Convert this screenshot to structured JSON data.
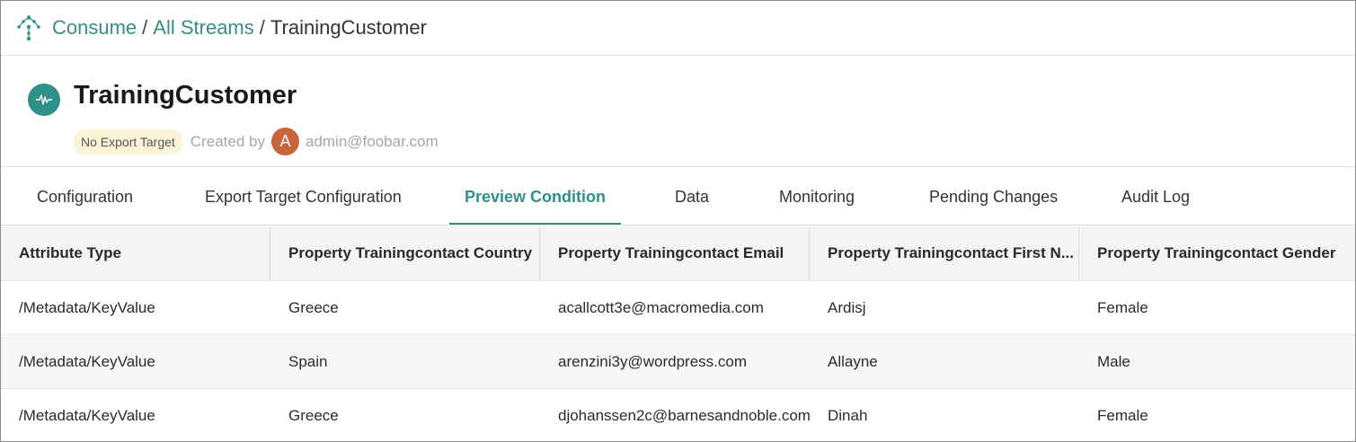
{
  "breadcrumb": {
    "items": [
      {
        "label": "Consume"
      },
      {
        "label": "All Streams"
      }
    ],
    "separator": "/",
    "current": "TrainingCustomer"
  },
  "header": {
    "title": "TrainingCustomer",
    "badge": "No Export Target",
    "created_by_label": "Created by",
    "avatar_initial": "A",
    "creator": "admin@foobar.com"
  },
  "tabs": [
    {
      "label": "Configuration"
    },
    {
      "label": "Export Target Configuration"
    },
    {
      "label": "Preview Condition",
      "active": true
    },
    {
      "label": "Data"
    },
    {
      "label": "Monitoring"
    },
    {
      "label": "Pending Changes"
    },
    {
      "label": "Audit Log"
    }
  ],
  "table": {
    "columns": [
      "Attribute Type",
      "Property Trainingcontact Country",
      "Property Trainingcontact Email",
      "Property Trainingcontact First N...",
      "Property Trainingcontact Gender"
    ],
    "rows": [
      [
        "/Metadata/KeyValue",
        "Greece",
        "acallcott3e@macromedia.com",
        "Ardisj",
        "Female"
      ],
      [
        "/Metadata/KeyValue",
        "Spain",
        "arenzini3y@wordpress.com",
        "Allayne",
        "Male"
      ],
      [
        "/Metadata/KeyValue",
        "Greece",
        "djohanssen2c@barnesandnoble.com",
        "Dinah",
        "Female"
      ]
    ]
  },
  "colors": {
    "accent": "#2f8f89",
    "link": "#3b8b86",
    "badge_bg": "#fdf4d7",
    "avatar_bg": "#c8633a"
  },
  "icons": {
    "logo": "stream-logo-icon",
    "stream": "waveform-icon"
  }
}
